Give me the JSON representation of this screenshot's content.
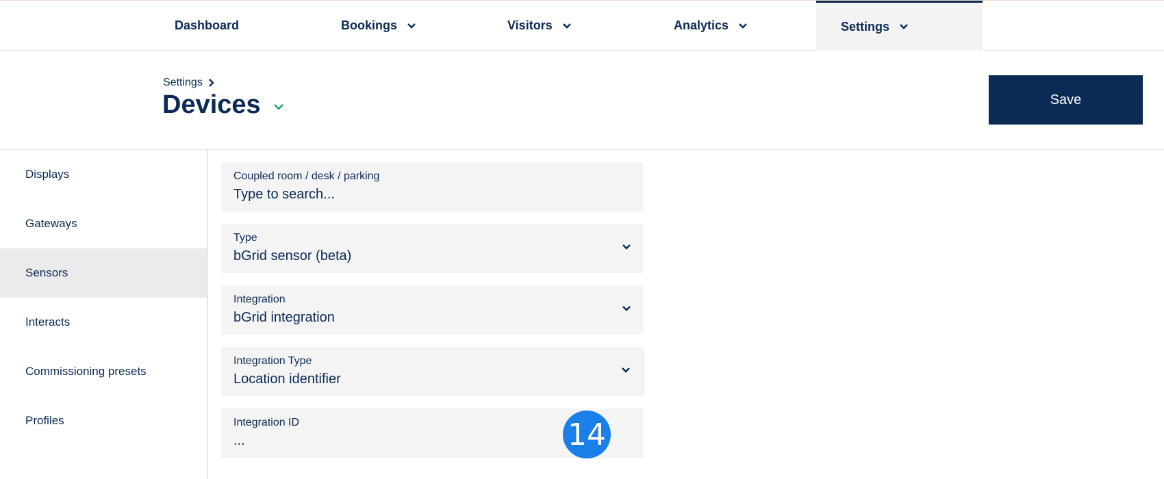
{
  "nav": {
    "items": [
      {
        "label": "Dashboard"
      },
      {
        "label": "Bookings"
      },
      {
        "label": "Visitors"
      },
      {
        "label": "Analytics"
      },
      {
        "label": "Settings"
      }
    ]
  },
  "header": {
    "breadcrumb": "Settings",
    "title": "Devices",
    "save_label": "Save"
  },
  "sidebar": {
    "items": [
      {
        "label": "Displays"
      },
      {
        "label": "Gateways"
      },
      {
        "label": "Sensors"
      },
      {
        "label": "Interacts"
      },
      {
        "label": "Commissioning presets"
      },
      {
        "label": "Profiles"
      }
    ]
  },
  "form": {
    "coupled": {
      "label": "Coupled room / desk / parking",
      "placeholder": "Type to search..."
    },
    "type": {
      "label": "Type",
      "value": "bGrid sensor (beta)"
    },
    "integration": {
      "label": "Integration",
      "value": "bGrid integration"
    },
    "integration_type": {
      "label": "Integration Type",
      "value": "Location identifier"
    },
    "integration_id": {
      "label": "Integration ID",
      "value": "..."
    }
  },
  "overlay": {
    "badge": "14"
  },
  "colors": {
    "primary": "#0b2a55",
    "accent_green": "#1aa35a",
    "badge_blue": "#1a7fe8"
  }
}
